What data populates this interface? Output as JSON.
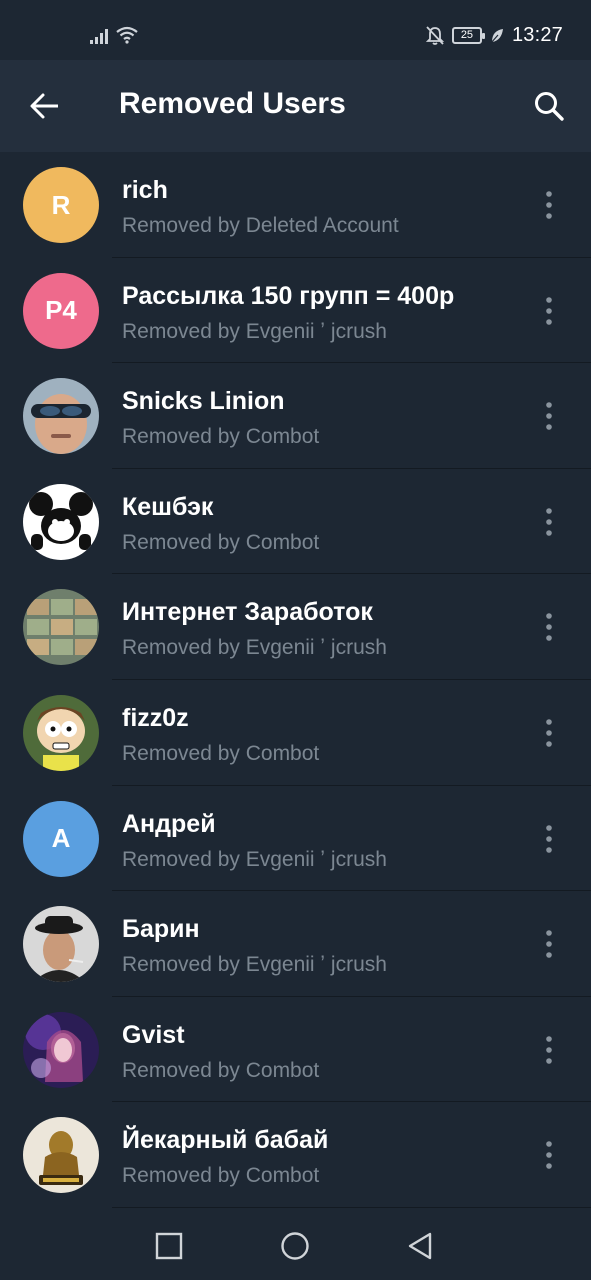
{
  "status_bar": {
    "time": "13:27",
    "battery": "25",
    "icons": [
      "signal-icon",
      "wifi-icon",
      "bell-off-icon",
      "battery-icon",
      "leaf-icon"
    ]
  },
  "header": {
    "title": "Removed Users",
    "back_icon": "arrow-left-icon",
    "search_icon": "search-icon"
  },
  "users": [
    {
      "name": "rich",
      "subtitle": "Removed by Deleted Account",
      "initials": "R",
      "avatar_color": "#f0b95e"
    },
    {
      "name": "Рассылка 150 групп = 400р",
      "subtitle": "Removed by Evgenii ʼ jcrush",
      "initials": "Р4",
      "avatar_color": "#ee6a8c"
    },
    {
      "name": "Snicks Linion",
      "subtitle": "Removed by Combot",
      "initials": "",
      "avatar_color": "#8aa0b0"
    },
    {
      "name": "Кешбэк",
      "subtitle": "Removed by Combot",
      "initials": "",
      "avatar_color": "#ffffff"
    },
    {
      "name": "Интернет Заработок",
      "subtitle": "Removed by Evgenii ʼ jcrush",
      "initials": "",
      "avatar_color": "#7a8f7a"
    },
    {
      "name": "fizz0z",
      "subtitle": "Removed by Combot",
      "initials": "",
      "avatar_color": "#4f6b3a"
    },
    {
      "name": "Андрей",
      "subtitle": "Removed by Evgenii ʼ jcrush",
      "initials": "А",
      "avatar_color": "#5a9fe0"
    },
    {
      "name": "Барин",
      "subtitle": "Removed by Evgenii ʼ jcrush",
      "initials": "",
      "avatar_color": "#d8d8d8"
    },
    {
      "name": "Gvist",
      "subtitle": "Removed by Combot",
      "initials": "",
      "avatar_color": "#3a2a6a"
    },
    {
      "name": "Йекарный бабай",
      "subtitle": "Removed by Combot",
      "initials": "",
      "avatar_color": "#e8e2d6"
    }
  ],
  "nav_bar": {
    "icons": [
      "square-recents-icon",
      "circle-home-icon",
      "triangle-back-icon"
    ]
  },
  "colors": {
    "background": "#1d2733",
    "header": "#242f3d",
    "subtitle": "#7c8792"
  }
}
